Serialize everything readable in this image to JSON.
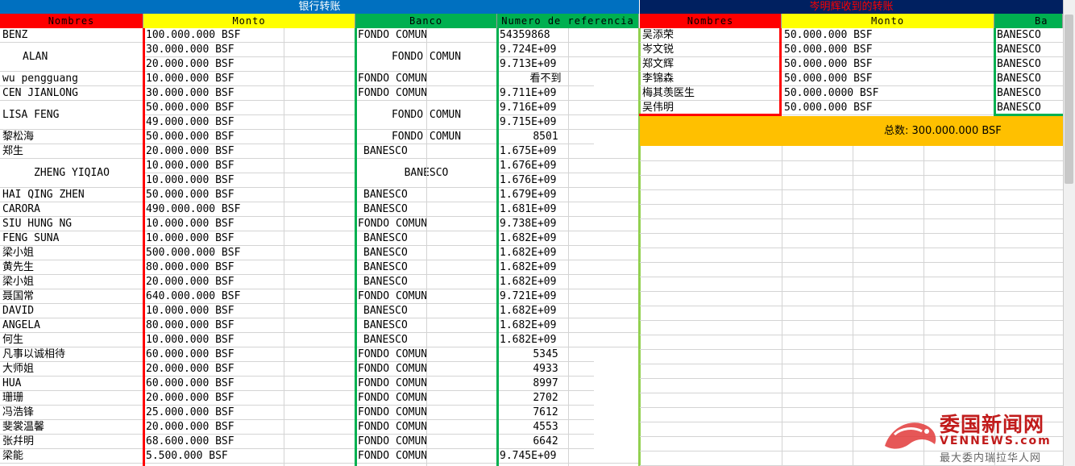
{
  "left": {
    "banner": "银行转账",
    "headers": [
      "Nombres",
      "Monto",
      "Banco",
      "Numero de referencia"
    ],
    "rows": [
      {
        "n": "BENZ",
        "m": "100.000.000 BSF",
        "b": "FONDO COMUN",
        "r": "54359868"
      },
      {
        "n": "ALAN",
        "m": "30.000.000 BSF",
        "b": "FONDO COMUN",
        "r": "9.724E+09"
      },
      {
        "n": "",
        "m": "20.000.000 BSF",
        "b": "",
        "r": "9.713E+09"
      },
      {
        "n": "wu pengguang",
        "m": "10.000.000 BSF",
        "b": "FONDO COMUN",
        "r": "看不到"
      },
      {
        "n": "CEN JIANLONG",
        "m": "30.000.000 BSF",
        "b": "FONDO COMUN",
        "r": "9.711E+09"
      },
      {
        "n": "LISA FENG",
        "m": "50.000.000 BSF",
        "b": "FONDO COMUN",
        "r": "9.716E+09"
      },
      {
        "n": "",
        "m": "49.000.000 BSF",
        "b": "",
        "r": "9.715E+09"
      },
      {
        "n": "黎松海",
        "m": "50.000.000 BSF",
        "b": "FONDO COMUN",
        "r": "8501"
      },
      {
        "n": "郑生",
        "m": "20.000.000 BSF",
        "b": "BANESCO",
        "r": "1.675E+09"
      },
      {
        "n": "ZHENG YIQIAO",
        "m": "10.000.000 BSF",
        "b": "BANESCO",
        "r": "1.676E+09"
      },
      {
        "n": "",
        "m": "10.000.000 BSF",
        "b": "",
        "r": "1.676E+09"
      },
      {
        "n": "HAI QING ZHEN",
        "m": "50.000.000 BSF",
        "b": "BANESCO",
        "r": "1.679E+09"
      },
      {
        "n": "CARORA",
        "m": "490.000.000 BSF",
        "b": "BANESCO",
        "r": "1.681E+09"
      },
      {
        "n": "SIU HUNG NG",
        "m": "10.000.000 BSF",
        "b": "FONDO COMUN",
        "r": "9.738E+09"
      },
      {
        "n": "FENG SUNA",
        "m": "10.000.000 BSF",
        "b": "BANESCO",
        "r": "1.682E+09"
      },
      {
        "n": "梁小姐",
        "m": "500.000.000 BSF",
        "b": "BANESCO",
        "r": "1.682E+09"
      },
      {
        "n": "黄先生",
        "m": "80.000.000 BSF",
        "b": "BANESCO",
        "r": "1.682E+09"
      },
      {
        "n": "梁小姐",
        "m": "20.000.000 BSF",
        "b": "BANESCO",
        "r": "1.682E+09"
      },
      {
        "n": "聂国常",
        "m": "640.000.000 BSF",
        "b": "FONDO COMUN",
        "r": "9.721E+09"
      },
      {
        "n": "DAVID",
        "m": "10.000.000 BSF",
        "b": "BANESCO",
        "r": "1.682E+09"
      },
      {
        "n": "ANGELA",
        "m": "80.000.000 BSF",
        "b": "BANESCO",
        "r": "1.682E+09"
      },
      {
        "n": "何生",
        "m": "10.000.000 BSF",
        "b": "BANESCO",
        "r": "1.682E+09"
      },
      {
        "n": "凡事以诚相待",
        "m": "60.000.000 BSF",
        "b": "FONDO COMUN",
        "r": "5345"
      },
      {
        "n": "大师姐",
        "m": "20.000.000 BSF",
        "b": "FONDO COMUN",
        "r": "4933"
      },
      {
        "n": "HUA",
        "m": "60.000.000 BSF",
        "b": "FONDO COMUN",
        "r": "8997"
      },
      {
        "n": "珊珊",
        "m": "20.000.000 BSF",
        "b": "FONDO COMUN",
        "r": "2702"
      },
      {
        "n": "冯浩锋",
        "m": "25.000.000 BSF",
        "b": "FONDO COMUN",
        "r": "7612"
      },
      {
        "n": "斐裳温馨",
        "m": "20.000.000 BSF",
        "b": "FONDO COMUN",
        "r": "4553"
      },
      {
        "n": "张幷明",
        "m": "68.600.000 BSF",
        "b": "FONDO COMUN",
        "r": "6642"
      },
      {
        "n": "梁能",
        "m": "5.500.000 BSF",
        "b": "FONDO COMUN",
        "r": "9.745E+09"
      }
    ]
  },
  "right": {
    "banner": "岑明辉收到的转账",
    "headers": [
      "Nombres",
      "Monto",
      "Ba"
    ],
    "rows": [
      {
        "n": "吴添荣",
        "m": "50.000.000 BSF",
        "b": "BANESCO"
      },
      {
        "n": "岑文锐",
        "m": "50.000.000 BSF",
        "b": "BANESCO"
      },
      {
        "n": "郑文辉",
        "m": "50.000.000 BSF",
        "b": "BANESCO"
      },
      {
        "n": "李锦森",
        "m": "50.000.000 BSF",
        "b": "BANESCO"
      },
      {
        "n": "梅其羡医生",
        "m": "50.000.0000 BSF",
        "b": "BANESCO"
      },
      {
        "n": "吴伟明",
        "m": "50.000.000 BSF",
        "b": "BANESCO"
      }
    ],
    "total": "总数: 300.000.000 BSF"
  },
  "watermark": {
    "brand": "委国新闻网",
    "url": "VENNEWS.com",
    "tagline": "最大委内瑞拉华人网"
  },
  "colors": {
    "blue_banner": "#0070c0",
    "navy_banner": "#002060",
    "red": "#ff0000",
    "yellow": "#ffff00",
    "green": "#00b050",
    "orange": "#ffc000",
    "right_banner_text": "#ff0000"
  }
}
